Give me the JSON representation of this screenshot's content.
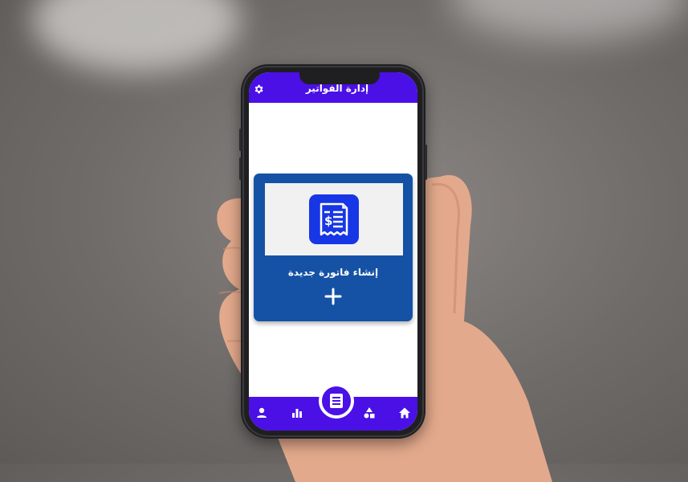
{
  "app": {
    "title": "إدارة الفواتير"
  },
  "card": {
    "label": "إنشاء فاتورة جديدة"
  },
  "icons": {
    "settings": "gear-icon",
    "invoice": "receipt-dollar-icon",
    "add": "plus-icon",
    "nav": [
      "person-icon",
      "bar-chart-icon",
      "invoice-list-icon",
      "shapes-icon",
      "home-icon"
    ]
  },
  "colors": {
    "app_bar": "#4a10e6",
    "card": "#1552a5",
    "invoice_icon_bg": "#1736e6",
    "screen_bg": "#ffffff"
  }
}
